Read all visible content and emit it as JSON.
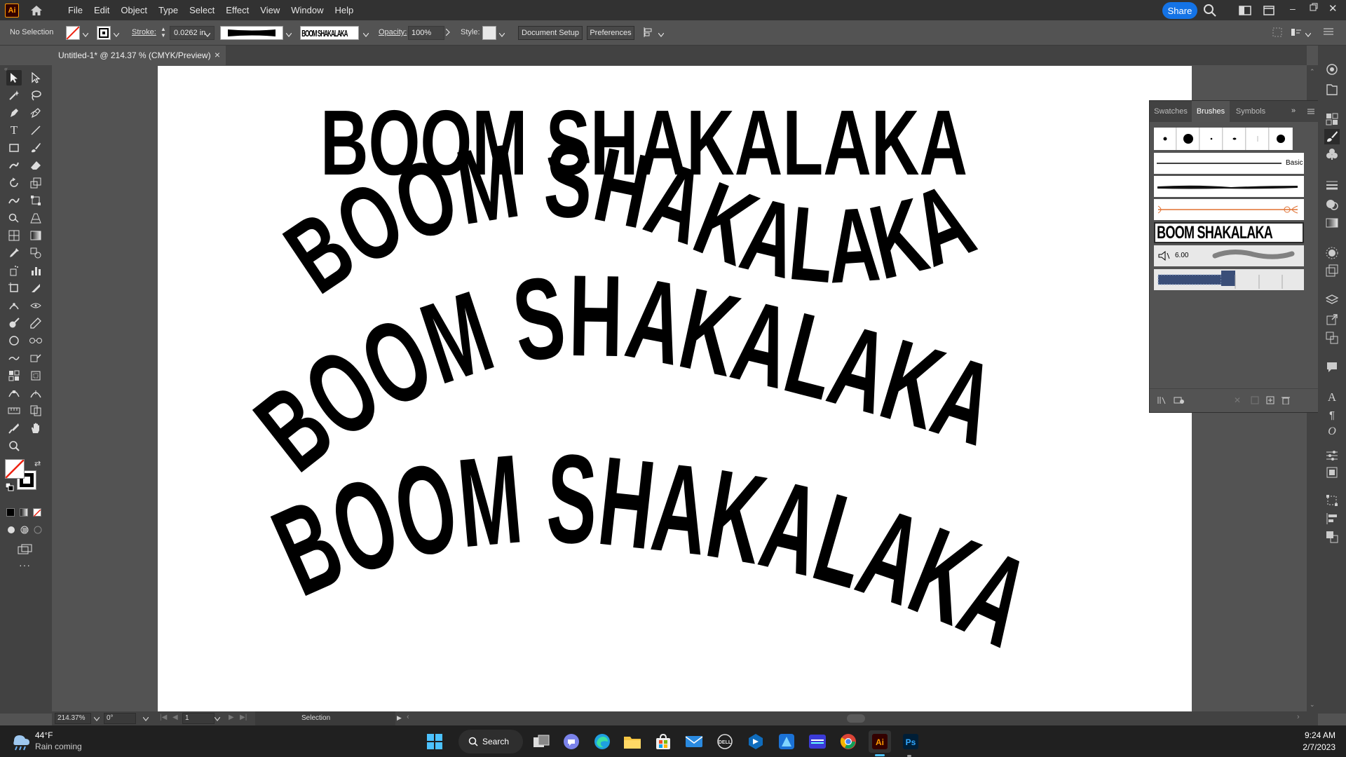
{
  "app": {
    "logo_text": "Ai"
  },
  "menu": [
    "File",
    "Edit",
    "Object",
    "Type",
    "Select",
    "Effect",
    "View",
    "Window",
    "Help"
  ],
  "share_label": "Share",
  "control": {
    "selection": "No Selection",
    "stroke_label": "Stroke:",
    "stroke_value": "0.0262 in",
    "brush_text": "BOOM SHAKALAKA",
    "opacity_label": "Opacity:",
    "opacity_value": "100%",
    "style_label": "Style:",
    "document_setup": "Document Setup",
    "preferences": "Preferences"
  },
  "tab": {
    "title": "Untitled-1* @ 214.37 % (CMYK/Preview)",
    "close": "×"
  },
  "artwork": {
    "line1": "BOOM SHAKALAKA",
    "line2": "BOOM SHAKALAKA",
    "line3": "BOOM SHAKALAKA",
    "line4": "BOOM SHAKALAKA"
  },
  "panel": {
    "tabs": [
      "Swatches",
      "Brushes",
      "Symbols"
    ],
    "active_tab": "Brushes",
    "basic_label": "Basic",
    "art_brush_text": "BOOM SHAKALAKA",
    "bristle_value": "6.00"
  },
  "status": {
    "zoom": "214.37%",
    "rotation": "0°",
    "artboard_num": "1",
    "tool_name": "Selection"
  },
  "taskbar": {
    "weather_temp": "44°F",
    "weather_desc": "Rain coming",
    "search_label": "Search",
    "time": "9:24 AM",
    "date": "2/7/2023"
  }
}
